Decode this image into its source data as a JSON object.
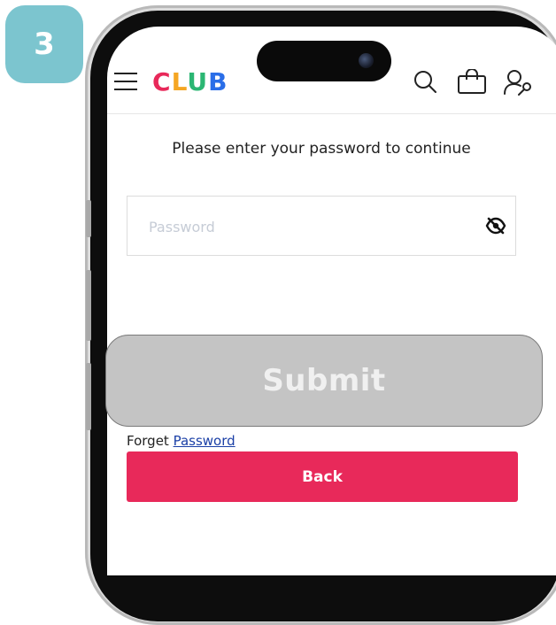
{
  "step_badge": "3",
  "header": {
    "logo_letters": [
      {
        "char": "C",
        "color": "#e8295a"
      },
      {
        "char": "L",
        "color": "#f5a623"
      },
      {
        "char": "U",
        "color": "#2bb673"
      },
      {
        "char": "B",
        "color": "#2a6ee8"
      }
    ],
    "icons": [
      "menu-icon",
      "search-icon",
      "shopping-bag-icon",
      "account-key-icon"
    ]
  },
  "form": {
    "prompt": "Please enter your password to continue",
    "password_placeholder": "Password",
    "password_value": "",
    "toggle_icon": "eye-slash-icon"
  },
  "submit_label": "Submit",
  "forget": {
    "prefix": "Forget",
    "link": "Password"
  },
  "back_label": "Back",
  "colors": {
    "badge": "#7cc5cf",
    "back_button": "#e8295a",
    "submit_button": "#c4c4c4",
    "link": "#1a3fa6"
  }
}
